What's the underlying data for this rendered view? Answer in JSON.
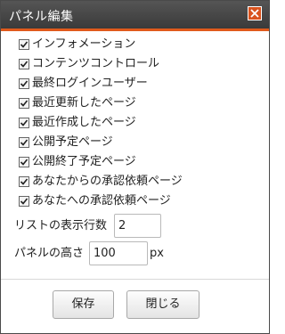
{
  "dialog": {
    "title": "パネル編集",
    "close_icon": "close-x-icon"
  },
  "options": [
    {
      "label": "インフォメーション",
      "checked": true
    },
    {
      "label": "コンテンツコントロール",
      "checked": true
    },
    {
      "label": "最終ログインユーザー",
      "checked": true
    },
    {
      "label": "最近更新したページ",
      "checked": true
    },
    {
      "label": "最近作成したページ",
      "checked": true
    },
    {
      "label": "公開予定ページ",
      "checked": true
    },
    {
      "label": "公開終了予定ページ",
      "checked": true
    },
    {
      "label": "あなたからの承認依頼ページ",
      "checked": true
    },
    {
      "label": "あなたへの承認依頼ページ",
      "checked": true
    }
  ],
  "list_count": {
    "label": "リストの表示行数",
    "value": "2"
  },
  "panel_height": {
    "label": "パネルの高さ",
    "value": "100",
    "unit": "px"
  },
  "buttons": {
    "save": "保存",
    "close": "閉じる"
  },
  "colors": {
    "accent": "#e05a1c",
    "titlebar": "#444444"
  }
}
